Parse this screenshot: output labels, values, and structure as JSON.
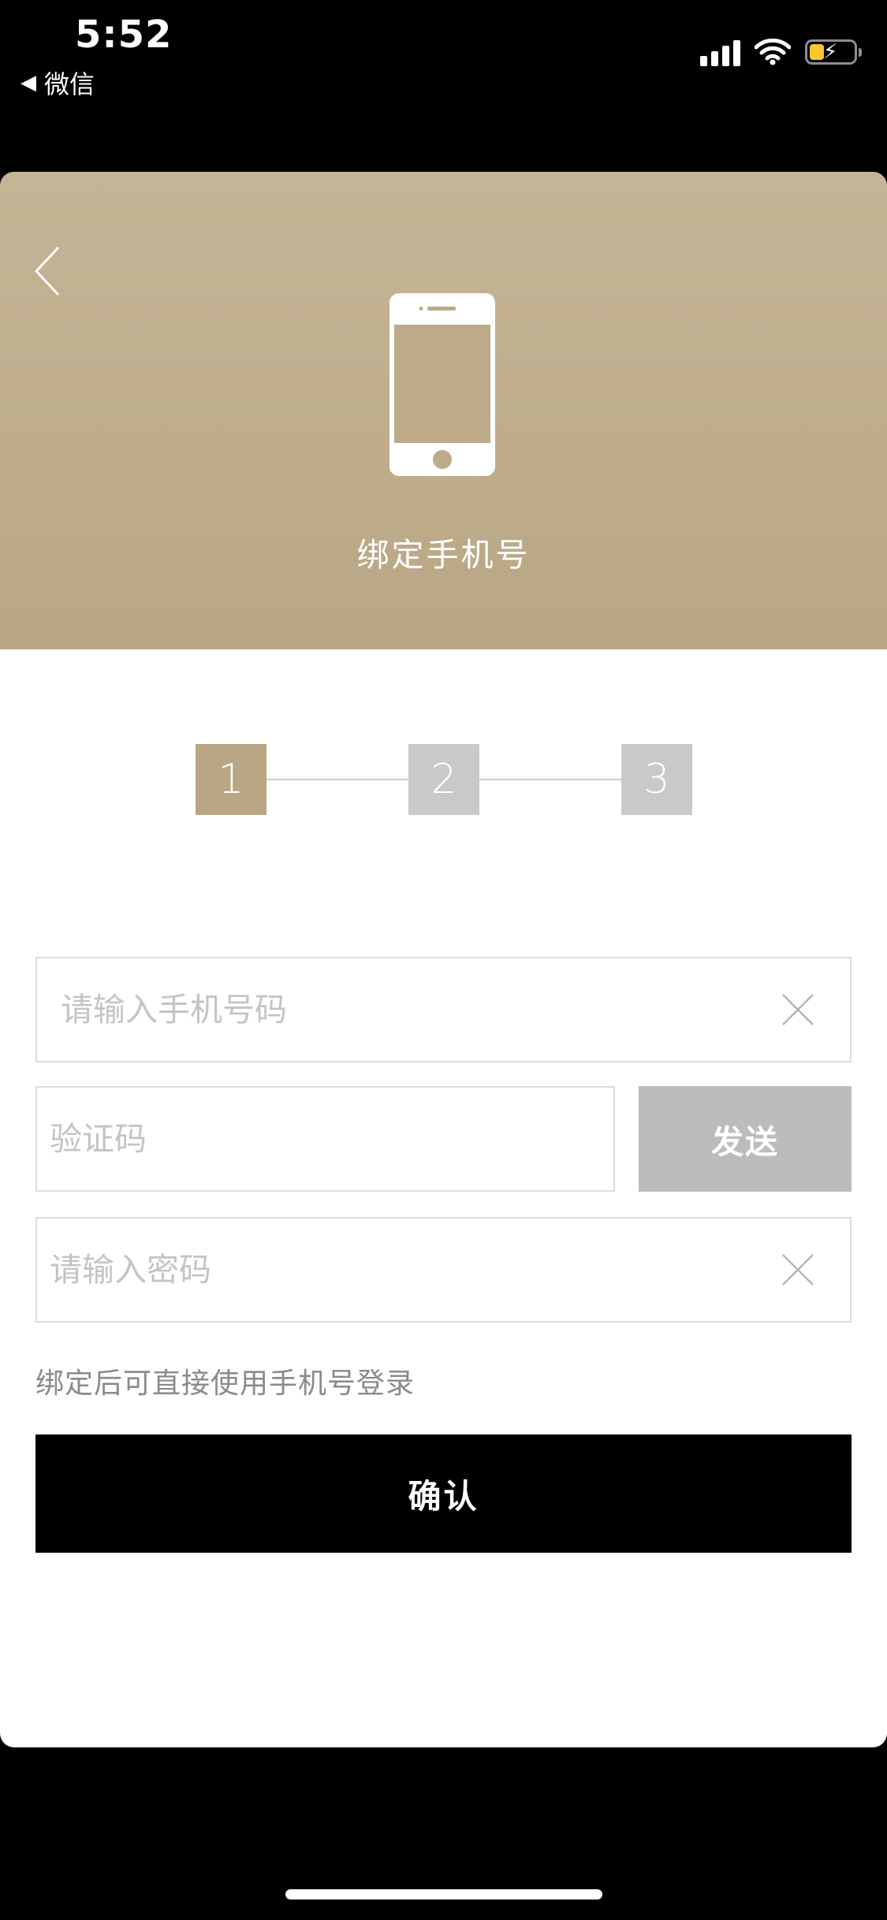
{
  "status_bar": {
    "time": "5:52",
    "back_app_label": "微信",
    "back_app_icon": "triangle-left-icon",
    "icons": [
      "signal-icon",
      "wifi-icon",
      "battery-charging-icon"
    ]
  },
  "header": {
    "title": "绑定手机号",
    "back_icon": "chevron-left-icon",
    "illustration_icon": "smartphone-icon",
    "background_color": "#BFAE8E"
  },
  "steps": {
    "items": [
      {
        "label": "1",
        "active": true
      },
      {
        "label": "2",
        "active": false
      },
      {
        "label": "3",
        "active": false
      }
    ],
    "active_color": "#B9A685",
    "inactive_color": "#C9C9C9"
  },
  "form": {
    "phone": {
      "placeholder": "请输入手机号码",
      "value": ""
    },
    "code": {
      "placeholder": "验证码",
      "value": ""
    },
    "send_label": "发送",
    "password": {
      "placeholder": "请输入密码",
      "value": ""
    },
    "hint": "绑定后可直接使用手机号登录",
    "confirm_label": "确认"
  }
}
